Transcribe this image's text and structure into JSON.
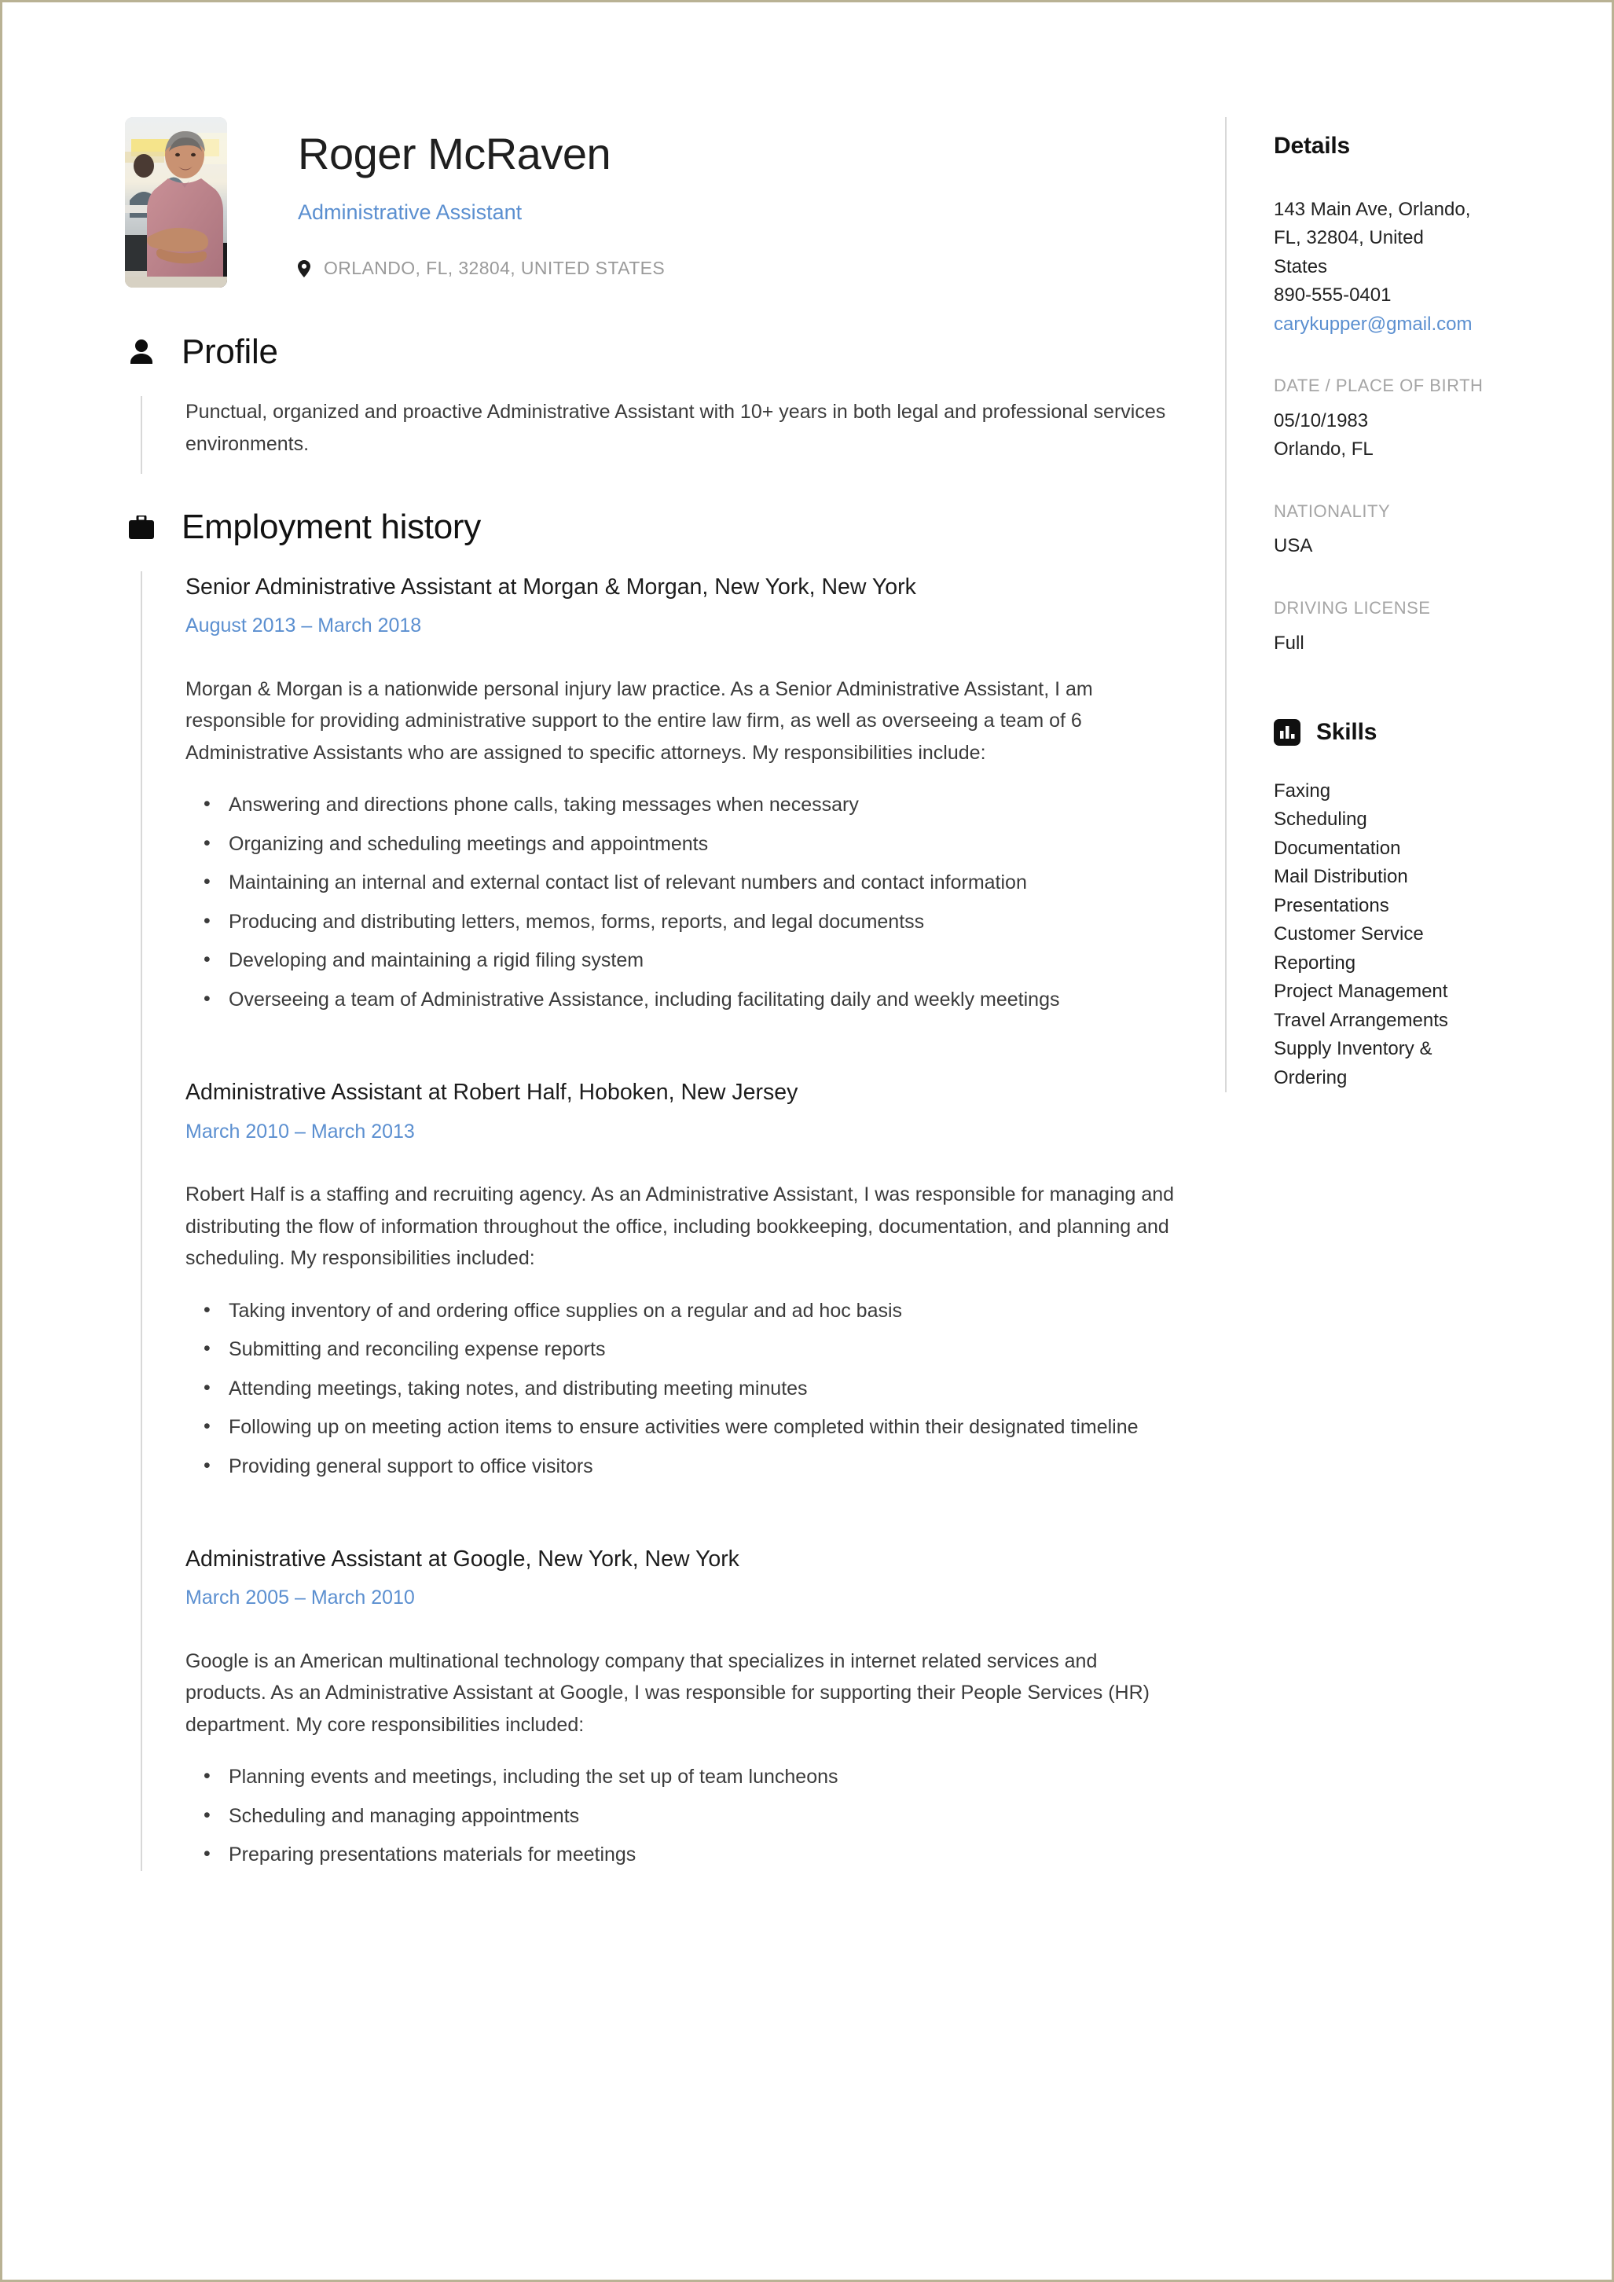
{
  "header": {
    "full_name": "Roger McRaven",
    "job_title": "Administrative Assistant",
    "location": "ORLANDO, FL, 32804, UNITED STATES",
    "location_icon": "map-pin-icon",
    "avatar_alt": "profile-photo"
  },
  "sections": {
    "profile": {
      "title": "Profile",
      "icon": "person-icon",
      "text": "Punctual, organized and proactive Administrative Assistant with 10+ years in both legal and professional services environments."
    },
    "employment": {
      "title": "Employment history",
      "icon": "briefcase-icon",
      "jobs": [
        {
          "heading": "Senior Administrative Assistant at Morgan & Morgan, New York, New York",
          "dates": "August 2013  –  March 2018",
          "description": "Morgan & Morgan is a nationwide personal injury law practice. As a Senior Administrative Assistant, I am responsible for providing administrative support to the entire law firm, as well as overseeing a team of 6 Administrative Assistants who are assigned to specific attorneys. My responsibilities include:",
          "bullets": [
            "Answering and directions phone calls, taking messages when necessary",
            "Organizing and scheduling meetings and appointments",
            "Maintaining an internal and external contact list of relevant numbers and contact information",
            "Producing and distributing letters, memos, forms, reports, and legal documentss",
            "Developing and maintaining a rigid filing system",
            "Overseeing a team of Administrative Assistance, including facilitating daily and weekly meetings"
          ]
        },
        {
          "heading": "Administrative Assistant at Robert Half, Hoboken, New Jersey",
          "dates": "March 2010  –  March 2013",
          "description": "Robert Half is a staffing and recruiting agency. As an Administrative Assistant, I was responsible for managing and distributing the flow of information throughout the office, including bookkeeping, documentation, and planning and scheduling. My responsibilities included:",
          "bullets": [
            "Taking inventory of and ordering office supplies on a regular and ad hoc basis",
            "Submitting and reconciling expense reports",
            "Attending meetings, taking notes, and distributing meeting minutes",
            "Following up on meeting action items to ensure activities were completed within their designated timeline",
            "Providing general support to office visitors"
          ]
        },
        {
          "heading": "Administrative Assistant at Google, New York, New York",
          "dates": "March 2005  –  March 2010",
          "description": "Google is an American multinational technology company that specializes in internet related services and products. As an Administrative Assistant at Google, I was responsible for supporting their People Services (HR) department. My core responsibilities included:",
          "bullets": [
            "Planning events and meetings, including the set up of team luncheons",
            "Scheduling and managing appointments",
            "Preparing presentations materials for meetings"
          ]
        }
      ]
    }
  },
  "sidebar": {
    "details": {
      "title": "Details",
      "address_line1": "143 Main Ave, Orlando,",
      "address_line2": "FL, 32804, United",
      "address_line3": "States",
      "phone": "890-555-0401",
      "email": "carykupper@gmail.com",
      "dob_label": "DATE / PLACE OF BIRTH",
      "dob_date": "05/10/1983",
      "dob_place": "Orlando, FL",
      "nationality_label": "NATIONALITY",
      "nationality": "USA",
      "driving_label": "DRIVING LICENSE",
      "driving": "Full"
    },
    "skills": {
      "title": "Skills",
      "icon": "bar-chart-icon",
      "items": [
        "Faxing",
        "Scheduling",
        "Documentation",
        "Mail Distribution",
        "Presentations",
        "Customer Service",
        "Reporting",
        "Project Management",
        "Travel Arrangements",
        "Supply Inventory &",
        "Ordering"
      ]
    }
  },
  "colors": {
    "accent_blue": "#5b8fd0",
    "text_dark": "#1c1c1c",
    "text_body": "#3b3b3b",
    "muted": "#a5a5a5",
    "rule": "#d8d8d8",
    "page_border": "#b9b294"
  }
}
